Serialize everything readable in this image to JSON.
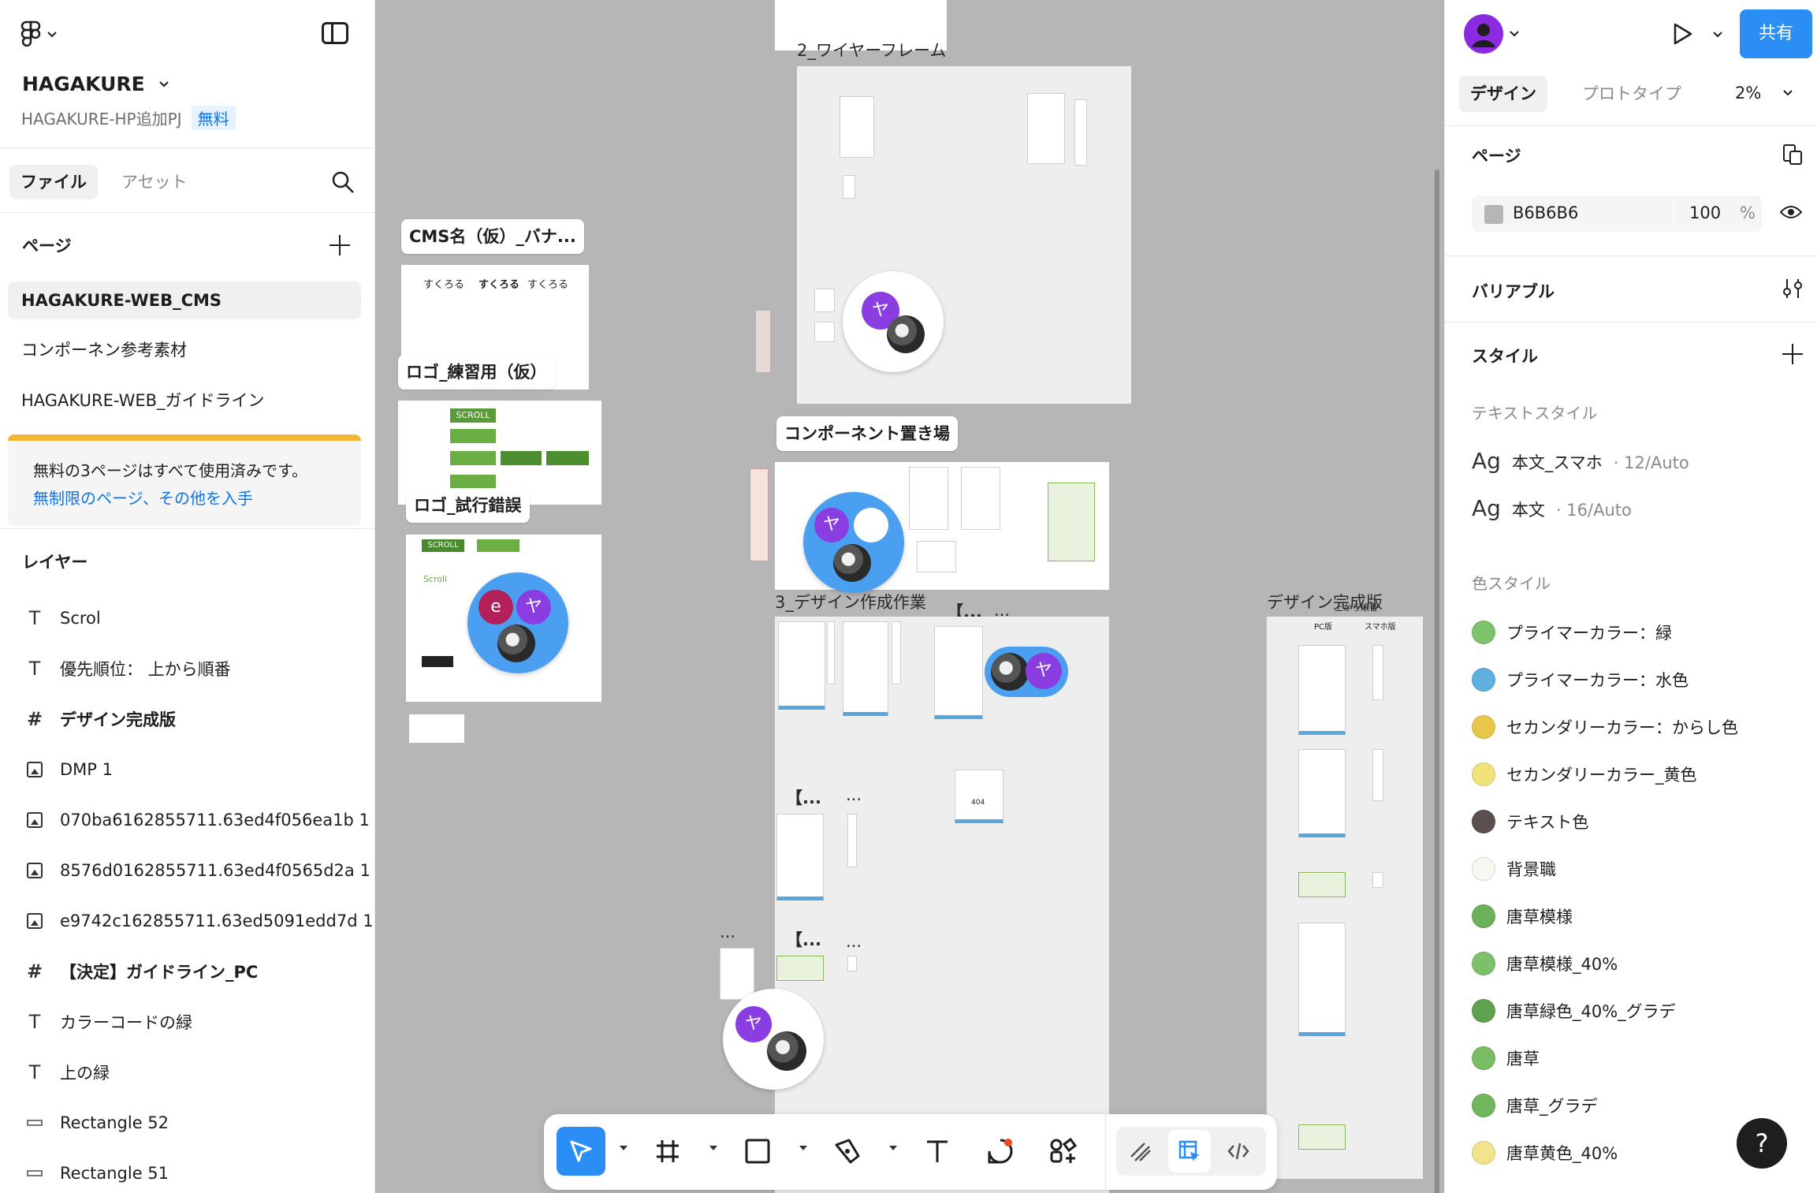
{
  "project": {
    "name": "HAGAKURE",
    "subtitle": "HAGAKURE-HP追加PJ",
    "plan_badge": "無料"
  },
  "left_tabs": {
    "file": "ファイル",
    "assets": "アセット"
  },
  "pages": {
    "title": "ページ",
    "items": [
      "HAGAKURE-WEB_CMS",
      "コンポーネン参考素材",
      "HAGAKURE-WEB_ガイドライン"
    ],
    "selected": "HAGAKURE-WEB_CMS"
  },
  "upsell": {
    "text": "無料の3ページはすべて使用済みです。",
    "link": "無制限のページ、その他を入手"
  },
  "layers": {
    "title": "レイヤー",
    "items": [
      {
        "type": "text",
        "name": "Scrol"
      },
      {
        "type": "text",
        "name": "優先順位： 上から順番"
      },
      {
        "type": "frame",
        "name": "デザイン完成版"
      },
      {
        "type": "image",
        "name": "DMP 1"
      },
      {
        "type": "image",
        "name": "070ba6162855711.63ed4f056ea1b 1"
      },
      {
        "type": "image",
        "name": "8576d0162855711.63ed4f0565d2a 1"
      },
      {
        "type": "image",
        "name": "e9742c162855711.63ed5091edd7d 1"
      },
      {
        "type": "frame",
        "name": "【決定】ガイドライン_PC"
      },
      {
        "type": "text",
        "name": "カラーコードの緑"
      },
      {
        "type": "text",
        "name": "上の緑"
      },
      {
        "type": "rect",
        "name": "Rectangle 52"
      },
      {
        "type": "rect",
        "name": "Rectangle 51"
      }
    ]
  },
  "canvas": {
    "labels": {
      "wireframe": "2_ワイヤーフレーム",
      "cms_banner": "CMS名（仮）_バナ...",
      "logo_practice": "ロゴ_練習用（仮）",
      "logo_trial": "ロゴ_試行錯誤",
      "component_place": "コンポーネント置き場",
      "design_work": "3_デザイン作成作業",
      "design_final": "デザイン完成版",
      "design_final_sub": "上から順番",
      "pc_label": "PC版",
      "sp_label": "スマホ版",
      "bracket_1": "【...",
      "bracket_2": "【...",
      "bracket_3": "【...",
      "ellipsis_1": "...",
      "ellipsis_2": "...",
      "ellipsis_3": "...",
      "ellipsis_4": "..."
    },
    "logo_texts": [
      "すくろる",
      "すくろる",
      "すくろる",
      "SCROLL",
      "SCROLL",
      "Scroll",
      "404"
    ],
    "avatars": [
      "ヤ",
      "ヤ",
      "e",
      "ヤ",
      "ヤ",
      "ヤ"
    ]
  },
  "toolbar": {
    "tools": [
      "move-tool",
      "frame-tool",
      "shape-tool",
      "pen-tool",
      "text-tool",
      "comment-tool",
      "actions-tool"
    ],
    "active": "move-tool"
  },
  "right": {
    "share": "共有",
    "tabs": [
      "デザイン",
      "プロトタイプ"
    ],
    "active_tab": "デザイン",
    "zoom": "2%",
    "page_section": "ページ",
    "page_color": "B6B6B6",
    "page_opacity": "100",
    "page_opacity_unit": "%",
    "variables": "バリアブル",
    "styles": "スタイル",
    "text_styles_title": "テキストスタイル",
    "text_styles": [
      {
        "ag": "Ag",
        "name": "本文_スマホ",
        "meta": "· 12/Auto"
      },
      {
        "ag": "Ag",
        "name": "本文",
        "meta": "· 16/Auto"
      }
    ],
    "color_styles_title": "色スタイル",
    "color_styles": [
      {
        "name": "プライマーカラー：緑",
        "color": "#7cc36a"
      },
      {
        "name": "プライマーカラー：水色",
        "color": "#5fb0e0"
      },
      {
        "name": "セカンダリーカラー：からし色",
        "color": "#e8c64a"
      },
      {
        "name": "セカンダリーカラー_黄色",
        "color": "#f2e27a"
      },
      {
        "name": "テキスト色",
        "color": "#5a4f4c"
      },
      {
        "name": "背景職",
        "color": "#f8f7f0"
      },
      {
        "name": "唐草模様",
        "color": "#6db05a"
      },
      {
        "name": "唐草模様_40%",
        "color": "#7cc06a"
      },
      {
        "name": "唐草緑色_40%_グラデ",
        "color": "#5fa24e"
      },
      {
        "name": "唐草",
        "color": "#78bd64"
      },
      {
        "name": "唐草_グラデ",
        "color": "#70b65c"
      },
      {
        "name": "唐草黄色_40%",
        "color": "#f2e48c"
      }
    ],
    "help": "?"
  }
}
